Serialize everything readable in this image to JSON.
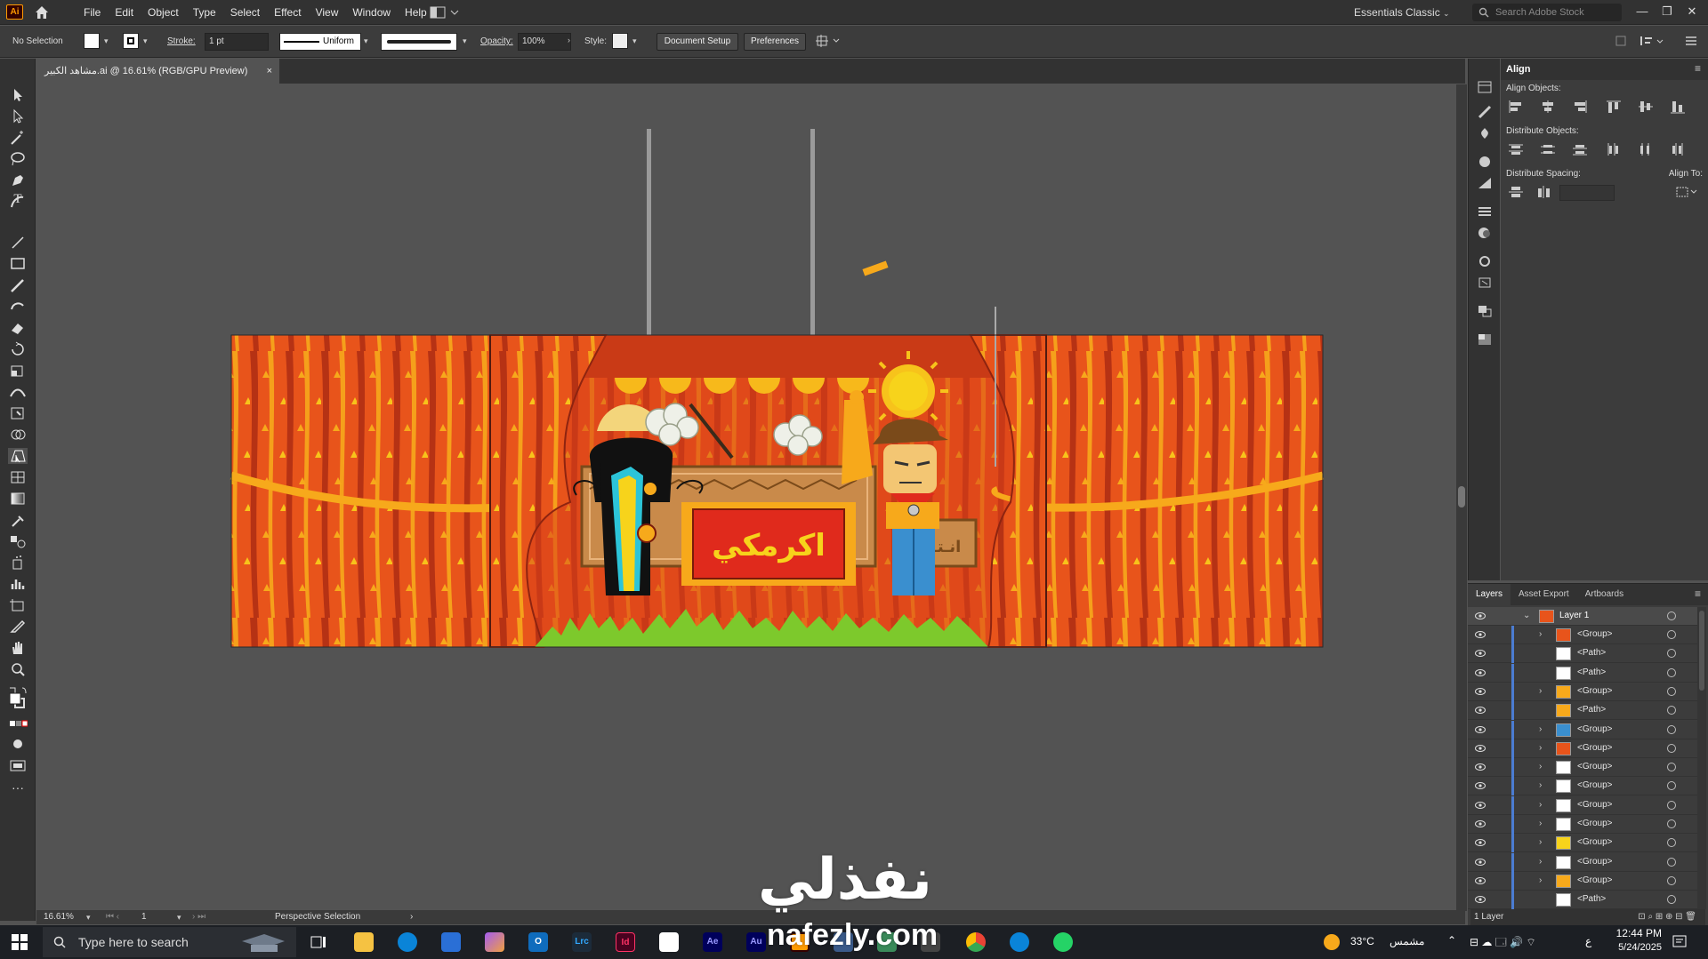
{
  "app": {
    "logo": "Ai",
    "workspace": "Essentials Classic",
    "search_placeholder": "Search Adobe Stock"
  },
  "menu": [
    "File",
    "Edit",
    "Object",
    "Type",
    "Select",
    "Effect",
    "View",
    "Window",
    "Help"
  ],
  "controlbar": {
    "selection": "No Selection",
    "stroke_label": "Stroke:",
    "stroke_value": "1 pt",
    "profile": "Uniform",
    "opacity_label": "Opacity:",
    "opacity_value": "100%",
    "style_label": "Style:",
    "document_setup": "Document Setup",
    "preferences": "Preferences"
  },
  "document_tab": {
    "title": "مشاهد الكبير.ai @ 16.61% (RGB/GPU Preview)",
    "close": "×"
  },
  "artwork": {
    "sign_text": "اكرمكي",
    "small_sign_text": "انـتـ"
  },
  "status": {
    "zoom": "16.61%",
    "artboard": "1",
    "tool": "Perspective Selection"
  },
  "align_panel": {
    "title": "Align",
    "align_objects": "Align Objects:",
    "distribute_objects": "Distribute Objects:",
    "distribute_spacing": "Distribute Spacing:",
    "align_to": "Align To:"
  },
  "layers_panel": {
    "tabs": [
      "Layers",
      "Asset Export",
      "Artboards"
    ],
    "layer_name": "Layer 1",
    "rows": [
      {
        "name": "<Group>",
        "expand": true
      },
      {
        "name": "<Path>",
        "expand": false
      },
      {
        "name": "<Path>",
        "expand": false
      },
      {
        "name": "<Group>",
        "expand": true
      },
      {
        "name": "<Path>",
        "expand": false
      },
      {
        "name": "<Group>",
        "expand": true
      },
      {
        "name": "<Group>",
        "expand": true
      },
      {
        "name": "<Group>",
        "expand": true
      },
      {
        "name": "<Group>",
        "expand": true
      },
      {
        "name": "<Group>",
        "expand": true
      },
      {
        "name": "<Group>",
        "expand": true
      },
      {
        "name": "<Group>",
        "expand": true
      },
      {
        "name": "<Group>",
        "expand": true
      },
      {
        "name": "<Group>",
        "expand": true
      },
      {
        "name": "<Path>",
        "expand": false
      }
    ],
    "footer": "1 Layer"
  },
  "taskbar": {
    "search": "Type here to search",
    "weather": "33°C",
    "weather_desc": "مشمس",
    "lang": "ع",
    "time": "12:44 PM",
    "date": "5/24/2025",
    "apps": [
      "Lrc",
      "Id",
      "Ae",
      "Au"
    ]
  },
  "watermark": {
    "arabic": "نفذلي",
    "latin": "nafezly.com"
  },
  "colors": {
    "curtain": "#e8541b",
    "curtain_dark": "#b63214",
    "gold": "#f7a91b",
    "grass": "#7dc92c",
    "sign_red": "#e02a1c",
    "layer_blue": "#4b7cd1"
  }
}
